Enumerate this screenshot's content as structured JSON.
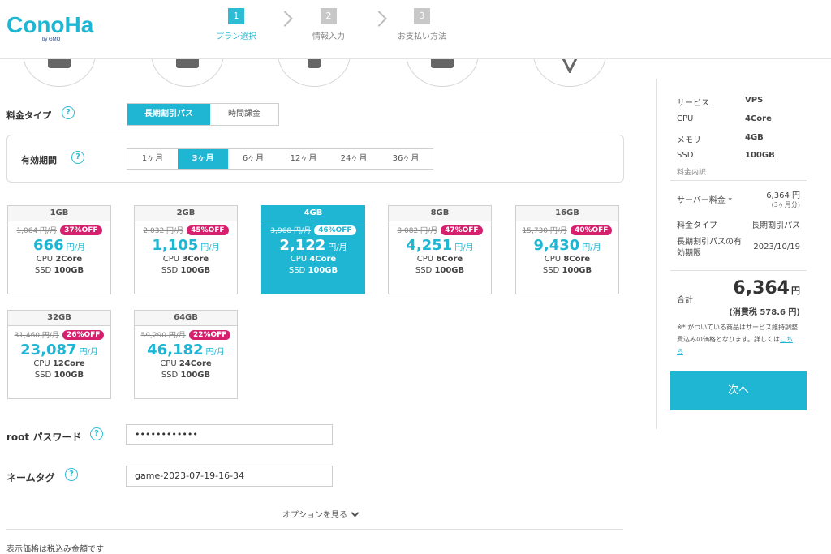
{
  "header": {
    "logo": "ConoHa",
    "logo_sub": "by GMO",
    "steps": [
      {
        "num": "1",
        "label": "プラン選択"
      },
      {
        "num": "2",
        "label": "情報入力"
      },
      {
        "num": "3",
        "label": "お支払い方法"
      }
    ]
  },
  "pricing": {
    "type_label": "料金タイプ",
    "type_options": [
      "長期割引パス",
      "時間課金"
    ],
    "period_label": "有効期間",
    "period_options": [
      "1ヶ月",
      "3ヶ月",
      "6ヶ月",
      "12ヶ月",
      "24ヶ月",
      "36ヶ月"
    ]
  },
  "plans": [
    {
      "name": "1GB",
      "orig": "1,064 円/月",
      "discount": "37%OFF",
      "price": "666",
      "unit": "円/月",
      "cpu": "2Core",
      "ssd": "100GB"
    },
    {
      "name": "2GB",
      "orig": "2,032 円/月",
      "discount": "45%OFF",
      "price": "1,105",
      "unit": "円/月",
      "cpu": "3Core",
      "ssd": "100GB"
    },
    {
      "name": "4GB",
      "orig": "3,968 円/月",
      "discount": "46%OFF",
      "price": "2,122",
      "unit": "円/月",
      "cpu": "4Core",
      "ssd": "100GB"
    },
    {
      "name": "8GB",
      "orig": "8,082 円/月",
      "discount": "47%OFF",
      "price": "4,251",
      "unit": "円/月",
      "cpu": "6Core",
      "ssd": "100GB"
    },
    {
      "name": "16GB",
      "orig": "15,730 円/月",
      "discount": "40%OFF",
      "price": "9,430",
      "unit": "円/月",
      "cpu": "8Core",
      "ssd": "100GB"
    },
    {
      "name": "32GB",
      "orig": "31,460 円/月",
      "discount": "26%OFF",
      "price": "23,087",
      "unit": "円/月",
      "cpu": "12Core",
      "ssd": "100GB"
    },
    {
      "name": "64GB",
      "orig": "59,290 円/月",
      "discount": "22%OFF",
      "price": "46,182",
      "unit": "円/月",
      "cpu": "24Core",
      "ssd": "100GB"
    }
  ],
  "spec_labels": {
    "cpu": "CPU",
    "ssd": "SSD"
  },
  "form": {
    "root_label": "root パスワード",
    "root_value": "••••••••••••",
    "tag_label": "ネームタグ",
    "tag_value": "game-2023-07-19-16-34",
    "options_link": "オプションを見る"
  },
  "footer_note": "表示価格は税込み金額です",
  "summary": {
    "service_k": "サービス",
    "service_v": "VPS",
    "cpu_k": "CPU",
    "cpu_v": "4Core",
    "mem_k": "メモリ",
    "mem_v": "4GB",
    "ssd_k": "SSD",
    "ssd_v": "100GB",
    "breakdown": "料金内訳",
    "server_fee_k": "サーバー料金 *",
    "server_fee_v": "6,364 円",
    "server_fee_note": "(3ヶ月分)",
    "type_k": "料金タイプ",
    "type_v": "長期割引パス",
    "expiry_k": "長期割引パスの有効期限",
    "expiry_v": "2023/10/19",
    "total_k": "合計",
    "total_v": "6,364",
    "total_unit": "円",
    "tax": "(消費税 578.6 円)",
    "note": "※* がついている商品はサービス維持調整費込みの価格となります。詳しくは",
    "note_link": "こちら",
    "next": "次へ"
  },
  "colors": {
    "accent": "#1fb6d3",
    "badge": "#d61f6d"
  }
}
